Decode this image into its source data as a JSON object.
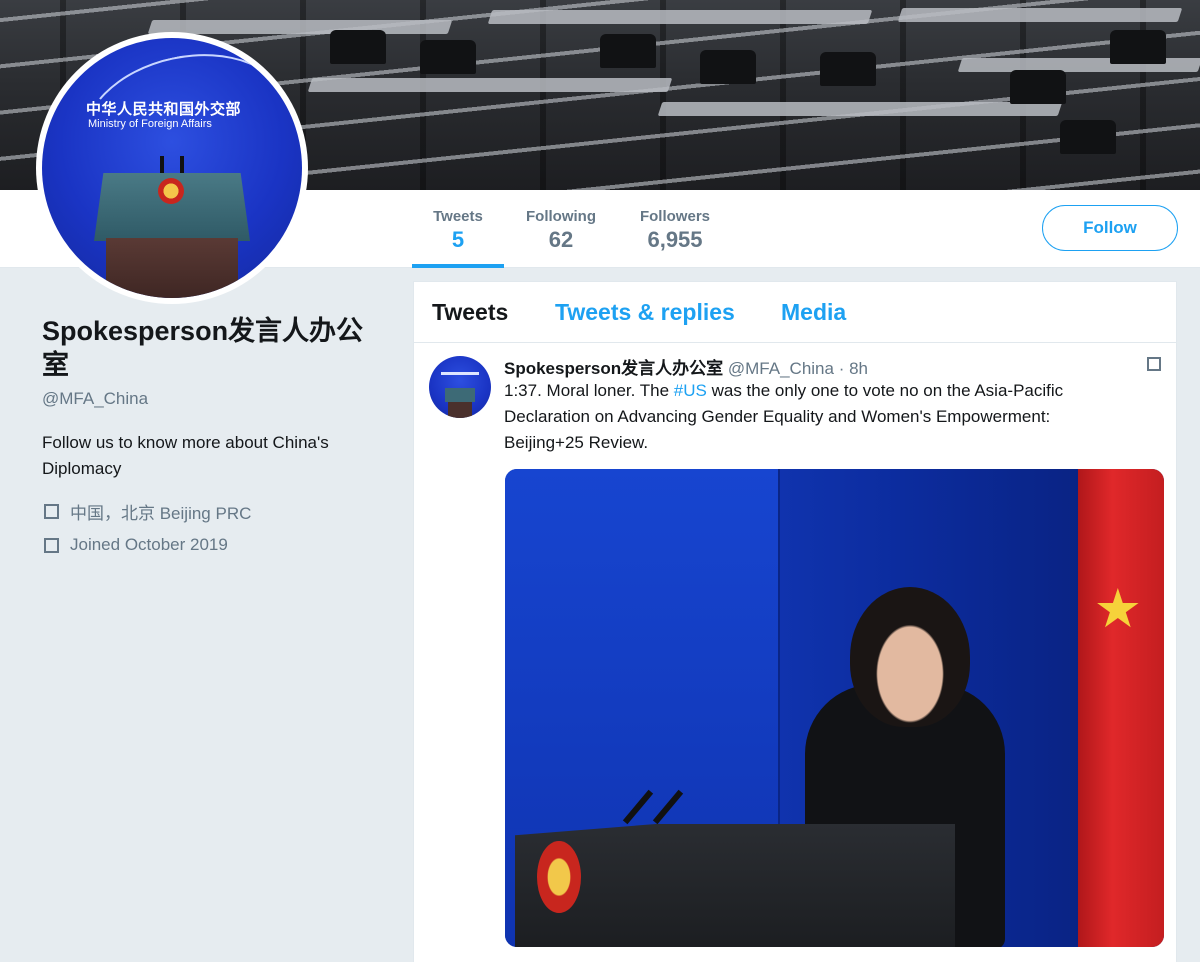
{
  "profile": {
    "name": "Spokesperson发言人办公室",
    "handle": "@MFA_China",
    "bio": "Follow us to know more about China's Diplomacy",
    "location": "中国，北京 Beijing PRC",
    "joined": "Joined October 2019",
    "avatar_text_cn": "中华人民共和国外交部",
    "avatar_text_en": "Ministry of Foreign Affairs"
  },
  "stats": [
    {
      "label": "Tweets",
      "value": "5"
    },
    {
      "label": "Following",
      "value": "62"
    },
    {
      "label": "Followers",
      "value": "6,955"
    }
  ],
  "follow_label": "Follow",
  "tabs": [
    {
      "label": "Tweets"
    },
    {
      "label": "Tweets & replies"
    },
    {
      "label": "Media"
    }
  ],
  "tweet": {
    "author": "Spokesperson发言人办公室",
    "handle_time": "@MFA_China · 8h",
    "text_before": "1:37. Moral loner. The ",
    "hashtag": "#US",
    "text_after": " was the only one to vote no on the Asia-Pacific Declaration on Advancing Gender Equality and Women's Empowerment: Beijing+25 Review."
  },
  "colors": {
    "accent": "#1da1f2",
    "background": "#e6ecf0",
    "secondary_text": "#657786"
  }
}
